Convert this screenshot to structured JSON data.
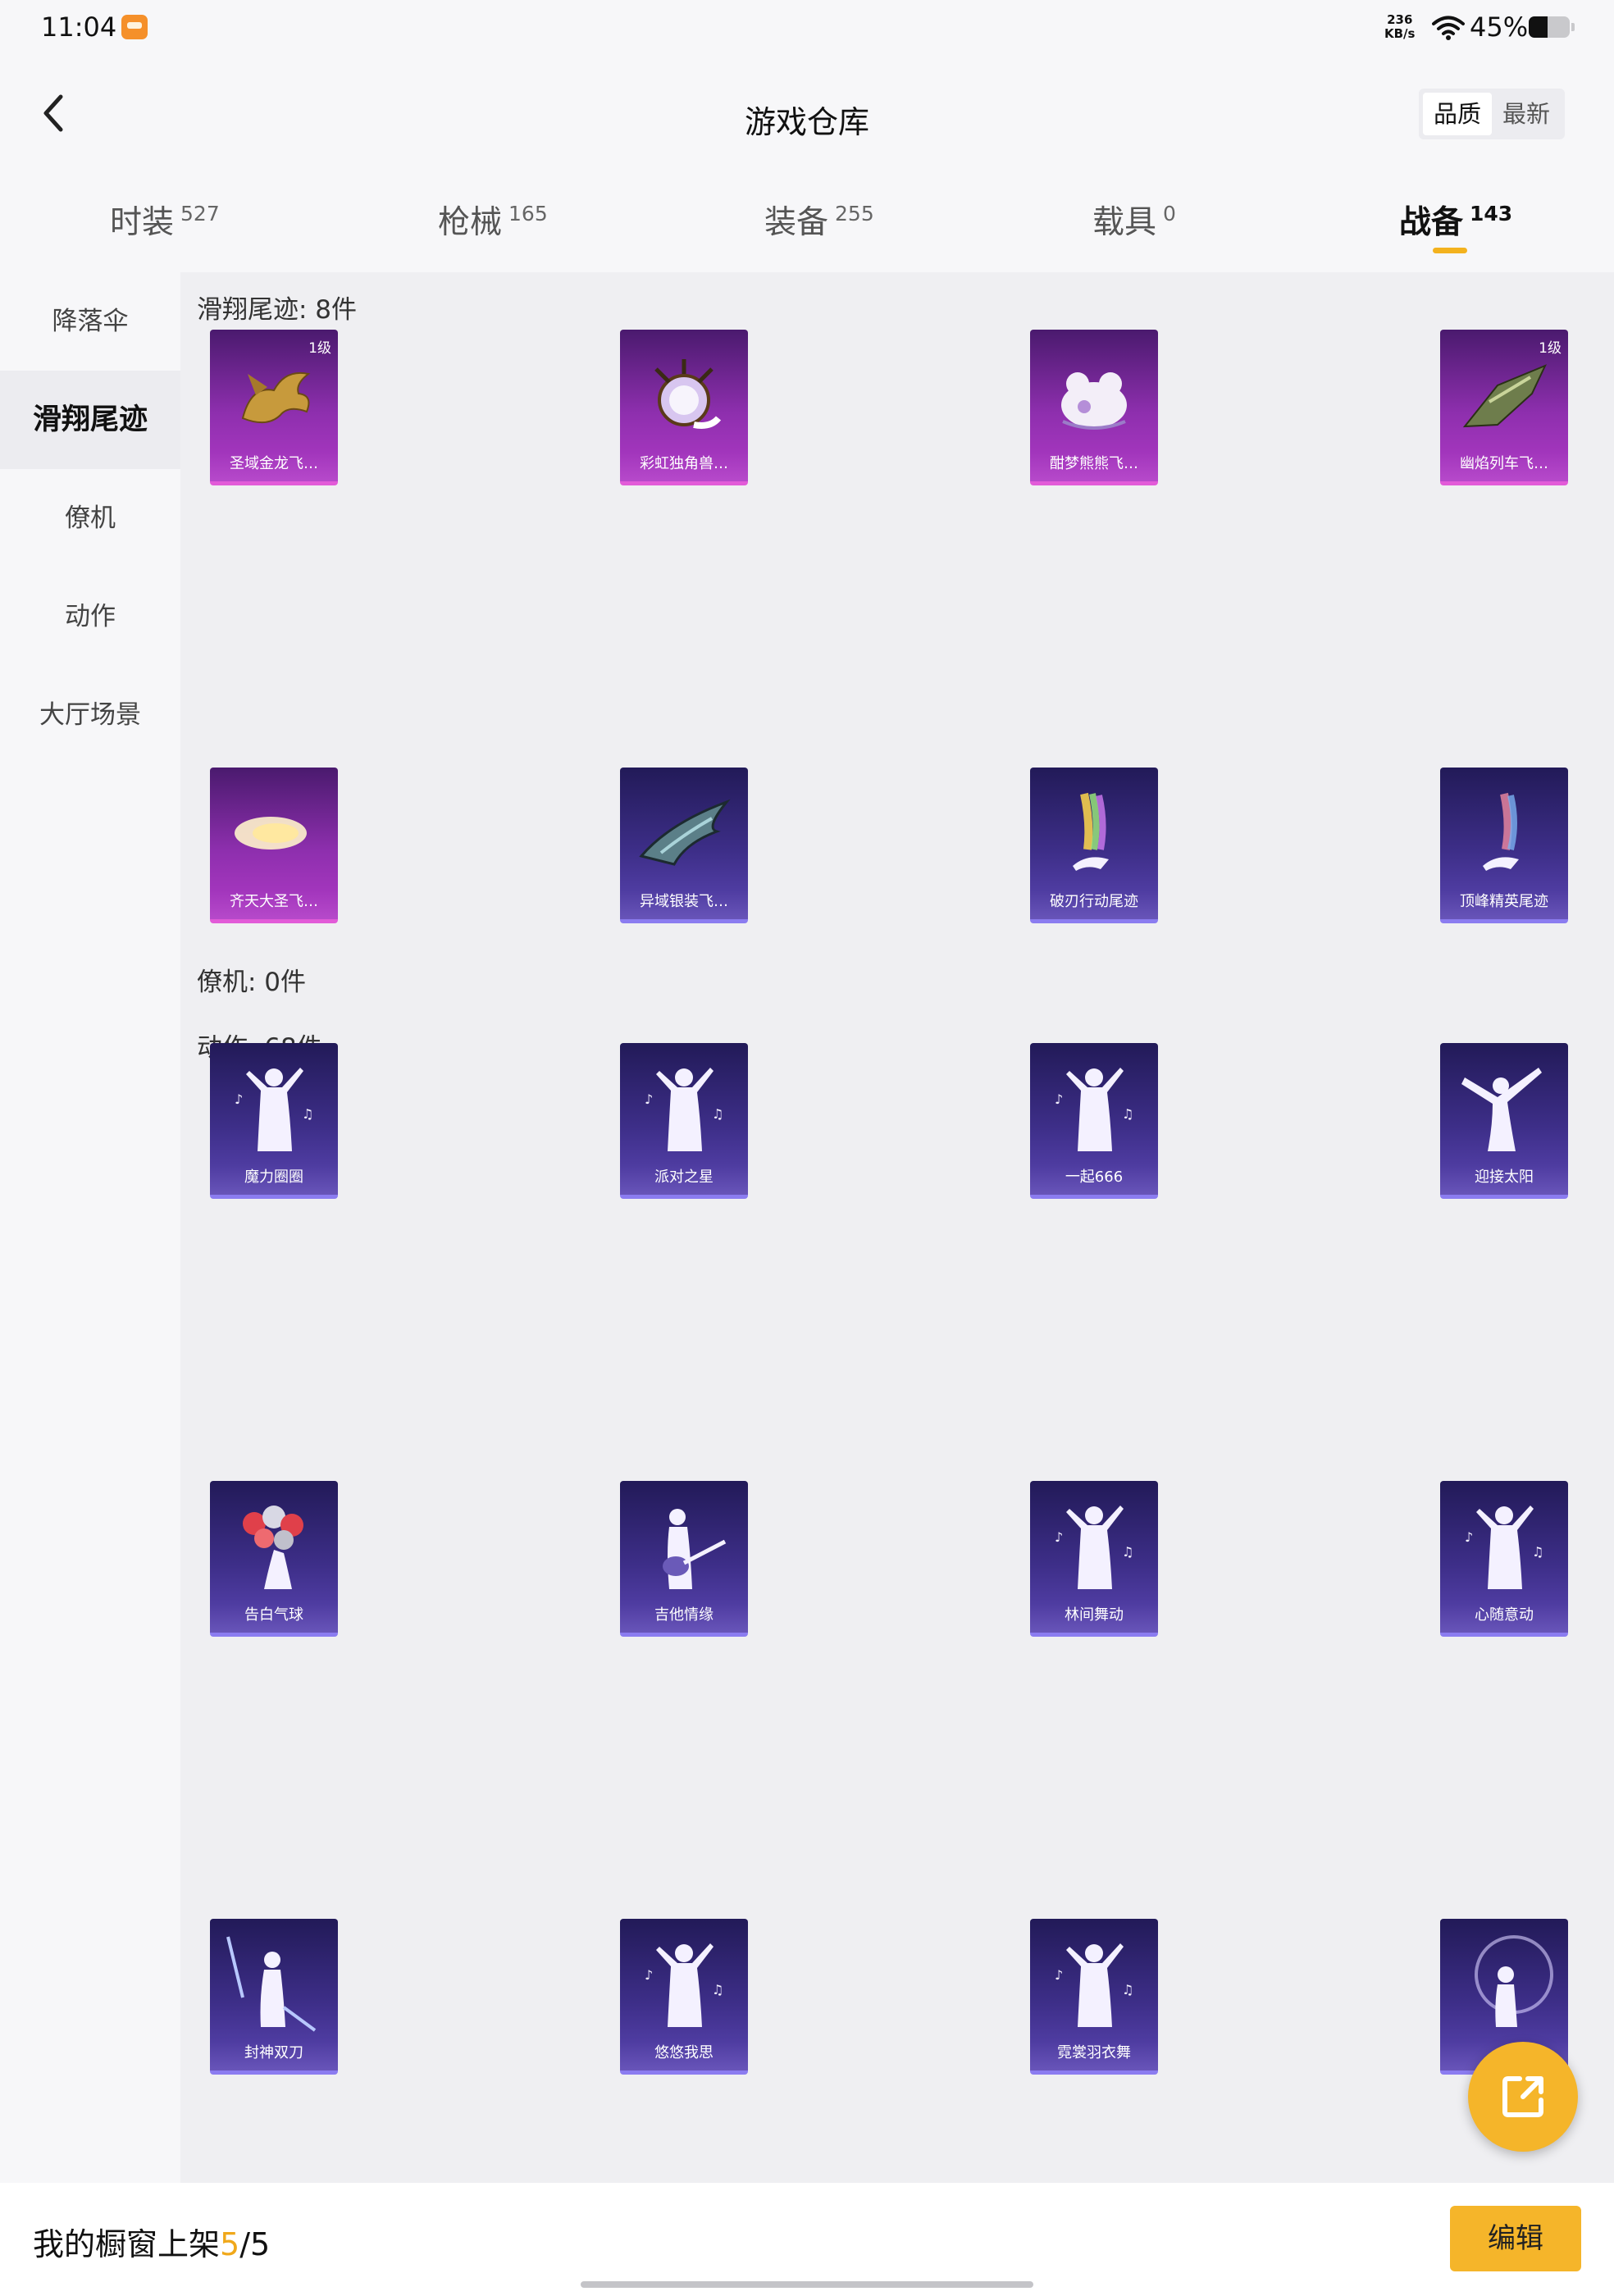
{
  "status_bar": {
    "time": "11:04",
    "net_speed_value": "236",
    "net_speed_unit": "KB/s",
    "battery_percent": "45%",
    "battery_level": 0.45
  },
  "header": {
    "title": "游戏仓库",
    "sort_options": [
      "品质",
      "最新"
    ],
    "sort_selected": "品质"
  },
  "tabs": [
    {
      "label": "时装",
      "count": "527"
    },
    {
      "label": "枪械",
      "count": "165"
    },
    {
      "label": "装备",
      "count": "255"
    },
    {
      "label": "载具",
      "count": "0"
    },
    {
      "label": "战备",
      "count": "143"
    }
  ],
  "active_tab": "战备",
  "categories": [
    "降落伞",
    "滑翔尾迹",
    "僚机",
    "动作",
    "大厅场景"
  ],
  "active_category": "滑翔尾迹",
  "sections": [
    {
      "header": "滑翔尾迹: 8件",
      "items": [
        {
          "name": "圣域金龙飞…",
          "level": "1级",
          "style": "purple",
          "icon": "golden-dragon-icon"
        },
        {
          "name": "彩虹独角兽…",
          "level": "",
          "style": "purple",
          "icon": "rainbow-unicorn-icon"
        },
        {
          "name": "酣梦熊熊飞…",
          "level": "",
          "style": "purple",
          "icon": "sleeping-bear-icon"
        },
        {
          "name": "幽焰列车飞…",
          "level": "1级",
          "style": "purple",
          "icon": "flame-train-icon"
        },
        {
          "name": "齐天大圣飞…",
          "level": "",
          "style": "purple",
          "icon": "monkey-king-cloud-icon"
        },
        {
          "name": "异域银装飞…",
          "level": "",
          "style": "navy",
          "icon": "silver-wing-icon"
        },
        {
          "name": "破刃行动尾迹",
          "level": "",
          "style": "navy",
          "icon": "rainbow-trail-icon"
        },
        {
          "name": "顶峰精英尾迹",
          "level": "",
          "style": "navy",
          "icon": "elite-trail-icon"
        }
      ]
    },
    {
      "header": "僚机: 0件",
      "items": []
    },
    {
      "header": "动作: 68件",
      "items": [
        {
          "name": "魔力圈圈",
          "level": "",
          "style": "navy",
          "icon": "dance-pose-icon"
        },
        {
          "name": "派对之星",
          "level": "",
          "style": "navy",
          "icon": "dance-pose-icon"
        },
        {
          "name": "一起666",
          "level": "",
          "style": "navy",
          "icon": "dance-pose-icon"
        },
        {
          "name": "迎接太阳",
          "level": "",
          "style": "navy",
          "icon": "dab-pose-icon"
        },
        {
          "name": "告白气球",
          "level": "",
          "style": "navy",
          "icon": "heart-balloons-icon"
        },
        {
          "name": "吉他情缘",
          "level": "",
          "style": "navy",
          "icon": "guitar-pose-icon"
        },
        {
          "name": "林间舞动",
          "level": "",
          "style": "navy",
          "icon": "dance-pose-icon"
        },
        {
          "name": "心随意动",
          "level": "",
          "style": "navy",
          "icon": "dance-pose-icon"
        },
        {
          "name": "封神双刀",
          "level": "",
          "style": "navy",
          "icon": "twin-blades-pose-icon"
        },
        {
          "name": "悠悠我思",
          "level": "",
          "style": "navy",
          "icon": "dance-pose-icon"
        },
        {
          "name": "霓裳羽衣舞",
          "level": "",
          "style": "navy",
          "icon": "dance-pose-icon"
        },
        {
          "name": "",
          "level": "",
          "style": "navy",
          "icon": "bubble-pose-icon"
        }
      ]
    }
  ],
  "bottom_bar": {
    "shelf_label": "我的橱窗上架",
    "shelf_current": "5",
    "shelf_separator": "/",
    "shelf_total": "5",
    "edit_label": "编辑"
  },
  "colors": {
    "accent": "#f5b52a",
    "purple_card": "#8e2fae",
    "navy_card": "#3d2e88"
  }
}
